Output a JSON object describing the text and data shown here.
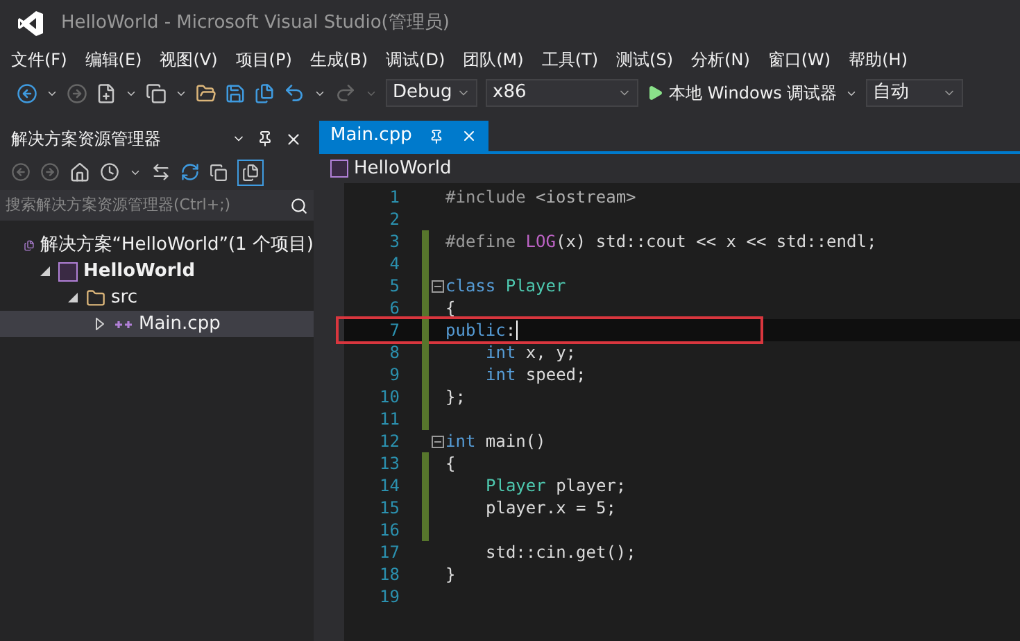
{
  "window": {
    "title": "HelloWorld - Microsoft Visual Studio(管理员)"
  },
  "menu": [
    "文件(F)",
    "编辑(E)",
    "视图(V)",
    "项目(P)",
    "生成(B)",
    "调试(D)",
    "团队(M)",
    "工具(T)",
    "测试(S)",
    "分析(N)",
    "窗口(W)",
    "帮助(H)"
  ],
  "toolbar": {
    "configuration": "Debug",
    "platform": "x86",
    "run_button": "本地 Windows 调试器",
    "target": "自动"
  },
  "solution_explorer": {
    "title": "解决方案资源管理器",
    "search": {
      "placeholder": "搜索解决方案资源管理器(Ctrl+;)"
    },
    "tree": [
      {
        "label": "解决方案“HelloWorld”(1 个项目)",
        "kind": "solution",
        "selected": false,
        "children": [
          {
            "label": "HelloWorld",
            "kind": "project",
            "expanded": true,
            "selected": false,
            "children": [
              {
                "label": "src",
                "kind": "folder",
                "expanded": true,
                "selected": false,
                "children": [
                  {
                    "label": "Main.cpp",
                    "kind": "file",
                    "expanded": false,
                    "selected": true
                  }
                ]
              }
            ]
          }
        ]
      }
    ]
  },
  "editor": {
    "tabs": [
      {
        "label": "Main.cpp",
        "selected": true
      }
    ],
    "navigation": "HelloWorld",
    "lines": [
      {
        "number": "1",
        "changed": false,
        "fold": false,
        "annotated": false,
        "indented": false,
        "tokens": [
          {
            "text": "#include ",
            "kind": "directive"
          },
          {
            "text": "<iostream>",
            "kind": "string"
          }
        ]
      },
      {
        "number": "2",
        "changed": false,
        "fold": false,
        "annotated": false
      },
      {
        "number": "3",
        "changed": true,
        "fold": false,
        "annotated": false,
        "indented": false,
        "tokens": [
          {
            "text": "#define ",
            "kind": "directive"
          },
          {
            "text": "LOG",
            "kind": "macro"
          },
          {
            "text": "(x) std::cout << x << std::endl;",
            "kind": "plain"
          }
        ]
      },
      {
        "number": "4",
        "changed": true,
        "fold": false,
        "annotated": false
      },
      {
        "number": "5",
        "changed": true,
        "fold": true,
        "annotated": false,
        "indented": false,
        "tokens": [
          {
            "text": "class",
            "kind": "keyword"
          },
          {
            "text": " Player",
            "kind": "type"
          }
        ]
      },
      {
        "number": "6",
        "changed": true,
        "fold": false,
        "annotated": false,
        "indented": false,
        "tokens": [
          {
            "text": "{",
            "kind": "plain"
          }
        ]
      },
      {
        "number": "7",
        "changed": true,
        "fold": false,
        "annotated": true,
        "indented": false,
        "tokens": [
          {
            "text": "public",
            "kind": "keyword"
          },
          {
            "text": ":",
            "kind": "plain"
          }
        ]
      },
      {
        "number": "8",
        "changed": true,
        "fold": false,
        "annotated": false,
        "indented": true,
        "tokens": [
          {
            "text": "int",
            "kind": "keyword"
          },
          {
            "text": " x, y;",
            "kind": "plain"
          }
        ]
      },
      {
        "number": "9",
        "changed": true,
        "fold": false,
        "annotated": false,
        "indented": true,
        "tokens": [
          {
            "text": "int",
            "kind": "keyword"
          },
          {
            "text": " speed;",
            "kind": "plain"
          }
        ]
      },
      {
        "number": "10",
        "changed": true,
        "fold": false,
        "annotated": false,
        "indented": false,
        "tokens": [
          {
            "text": "};",
            "kind": "plain"
          }
        ]
      },
      {
        "number": "11",
        "changed": true,
        "fold": false,
        "annotated": false
      },
      {
        "number": "12",
        "changed": false,
        "fold": true,
        "annotated": false,
        "indented": false,
        "tokens": [
          {
            "text": "int",
            "kind": "keyword"
          },
          {
            "text": " main()",
            "kind": "plain"
          }
        ]
      },
      {
        "number": "13",
        "changed": true,
        "fold": false,
        "annotated": false,
        "indented": false,
        "tokens": [
          {
            "text": "{",
            "kind": "plain"
          }
        ]
      },
      {
        "number": "14",
        "changed": true,
        "fold": false,
        "annotated": false,
        "indented": true,
        "tokens": [
          {
            "text": "Player",
            "kind": "type"
          },
          {
            "text": " player;",
            "kind": "plain"
          }
        ]
      },
      {
        "number": "15",
        "changed": true,
        "fold": false,
        "annotated": false,
        "indented": true,
        "tokens": [
          {
            "text": "player.x = 5;",
            "kind": "plain"
          }
        ]
      },
      {
        "number": "16",
        "changed": true,
        "fold": false,
        "annotated": false
      },
      {
        "number": "17",
        "changed": false,
        "fold": false,
        "annotated": false,
        "indented": true,
        "tokens": [
          {
            "text": "std::cin.get();",
            "kind": "plain"
          }
        ]
      },
      {
        "number": "18",
        "changed": false,
        "fold": false,
        "annotated": false,
        "indented": false,
        "tokens": [
          {
            "text": "}",
            "kind": "plain"
          }
        ]
      },
      {
        "number": "19",
        "changed": false,
        "fold": false,
        "annotated": false
      }
    ]
  }
}
